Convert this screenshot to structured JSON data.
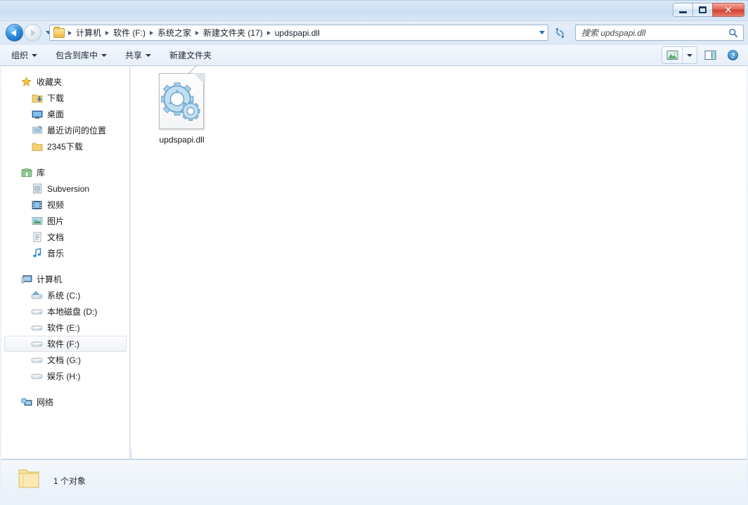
{
  "window": {
    "title": "",
    "controls": {
      "minimize": "minimize-button",
      "maximize": "maximize-button",
      "close_glyph": "✕"
    }
  },
  "addressbar": {
    "back_tooltip": "后退",
    "forward_tooltip": "前进",
    "history_dropdown": "最近浏览的位置",
    "breadcrumbs": [
      {
        "label": "计算机"
      },
      {
        "label": "软件 (F:)"
      },
      {
        "label": "系统之家"
      },
      {
        "label": "新建文件夹 (17)"
      },
      {
        "label": "updspapi.dll"
      }
    ],
    "separator": "▸",
    "dropdown_label": "▾",
    "refresh_label": "刷新"
  },
  "search": {
    "placeholder": "搜索 updspapi.dll",
    "value": "",
    "icon": "search-icon"
  },
  "toolbar": {
    "items": [
      {
        "label": "组织",
        "has_caret": true
      },
      {
        "label": "包含到库中",
        "has_caret": true
      },
      {
        "label": "共享",
        "has_caret": true
      },
      {
        "label": "新建文件夹",
        "has_caret": false
      }
    ],
    "right_buttons": [
      {
        "name": "change-view-button",
        "icon": "view-icon"
      },
      {
        "name": "change-view-dropdown",
        "icon": "chevron-down-icon"
      },
      {
        "name": "preview-pane-button",
        "icon": "preview-pane-icon"
      },
      {
        "name": "help-button",
        "icon": "help-icon"
      }
    ]
  },
  "sidebar": {
    "groups": [
      {
        "header": {
          "label": "收藏夹",
          "icon": "star-icon"
        },
        "items": [
          {
            "label": "下载",
            "icon": "downloads-icon",
            "selected": false
          },
          {
            "label": "桌面",
            "icon": "desktop-icon",
            "selected": false
          },
          {
            "label": "最近访问的位置",
            "icon": "recent-places-icon",
            "selected": false
          },
          {
            "label": "2345下载",
            "icon": "folder-icon",
            "selected": false
          }
        ]
      },
      {
        "header": {
          "label": "库",
          "icon": "library-icon"
        },
        "items": [
          {
            "label": "Subversion",
            "icon": "subversion-icon",
            "selected": false
          },
          {
            "label": "视频",
            "icon": "videos-icon",
            "selected": false
          },
          {
            "label": "图片",
            "icon": "pictures-icon",
            "selected": false
          },
          {
            "label": "文档",
            "icon": "documents-icon",
            "selected": false
          },
          {
            "label": "音乐",
            "icon": "music-icon",
            "selected": false
          }
        ]
      },
      {
        "header": {
          "label": "计算机",
          "icon": "computer-icon"
        },
        "items": [
          {
            "label": "系统 (C:)",
            "icon": "system-drive-icon",
            "selected": false
          },
          {
            "label": "本地磁盘 (D:)",
            "icon": "drive-icon",
            "selected": false
          },
          {
            "label": "软件 (E:)",
            "icon": "drive-icon",
            "selected": false
          },
          {
            "label": "软件 (F:)",
            "icon": "drive-icon",
            "selected": true
          },
          {
            "label": "文档 (G:)",
            "icon": "drive-icon",
            "selected": false
          },
          {
            "label": "娱乐 (H:)",
            "icon": "drive-icon",
            "selected": false
          }
        ]
      },
      {
        "header": {
          "label": "网络",
          "icon": "network-icon"
        },
        "items": []
      }
    ]
  },
  "filepane": {
    "items": [
      {
        "name": "updspapi.dll",
        "icon": "dll-file-icon",
        "selected": false
      }
    ]
  },
  "statusbar": {
    "icon": "folder-icon",
    "text": "1 个对象"
  },
  "colors": {
    "titlebar_top": "#dce9f7",
    "accent_blue": "#2f8fe0",
    "close_red": "#d0412f",
    "folder_yellow": "#f5cf6a",
    "selection_border": "#dde3ea"
  }
}
